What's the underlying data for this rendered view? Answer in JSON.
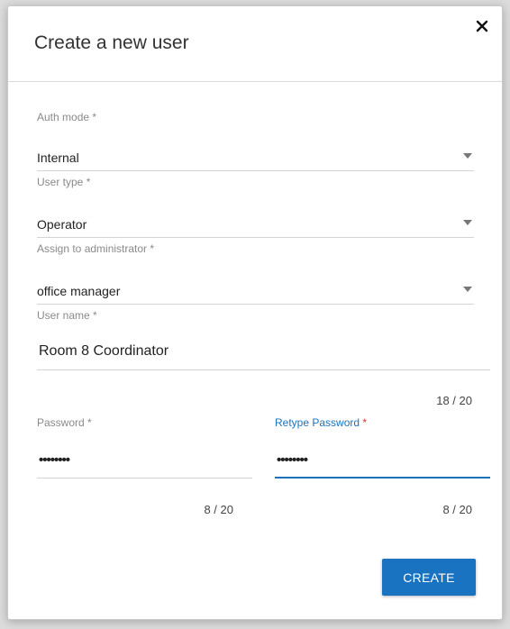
{
  "dialog": {
    "title": "Create a new user",
    "close_icon": "close-icon"
  },
  "auth_mode": {
    "label": "Auth mode",
    "required_mark": "*",
    "value": "Internal"
  },
  "user_type": {
    "label": "User type",
    "required_mark": "*",
    "value": "Operator"
  },
  "assign_admin": {
    "label": "Assign to administrator",
    "required_mark": "*",
    "value": "office manager"
  },
  "user_name": {
    "label": "User name",
    "required_mark": "*",
    "value": "Room 8 Coordinator",
    "counter": "18 / 20"
  },
  "password": {
    "label": "Password",
    "required_mark": "*",
    "value": "••••••••",
    "counter": "8 / 20"
  },
  "retype_password": {
    "label": "Retype Password",
    "required_mark": "*",
    "value": "••••••••",
    "counter": "8 / 20"
  },
  "actions": {
    "create_label": "CREATE"
  },
  "colors": {
    "accent": "#1a73c0",
    "required_active": "#d83030"
  }
}
